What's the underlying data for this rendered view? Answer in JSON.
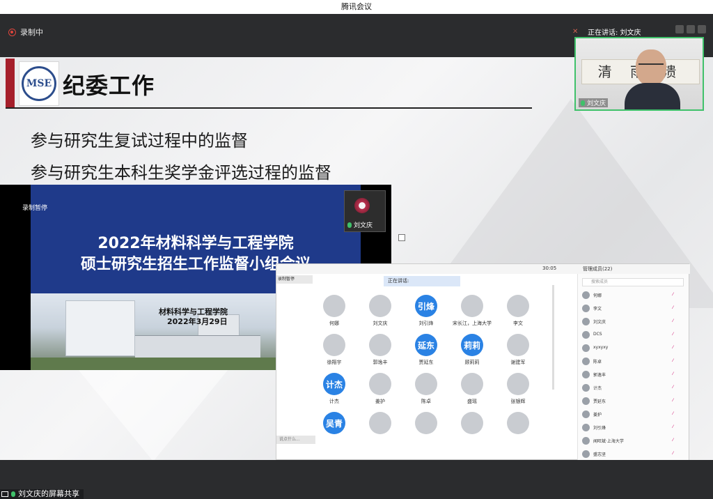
{
  "window": {
    "title": "腾讯会议"
  },
  "topbar": {
    "recording_label": "录制中",
    "speaking_label": "正在讲话: 刘文庆"
  },
  "slide": {
    "logo_text": "MSE",
    "title": "纪委工作",
    "bullets": [
      "参与研究生复试过程中的监督",
      "参与研究生本科生奖学金评选过程的监督"
    ]
  },
  "inner_screen_1": {
    "recording_paused": "录制暂停",
    "heading_line1": "2022年材料科学与工程学院",
    "heading_line2": "硕士研究生招生工作监督小组会议",
    "sub_line1": "材料科学与工程学院",
    "sub_line2": "2022年3月29日",
    "cam_name": "刘文庆"
  },
  "inner_screen_2": {
    "time": "30:05",
    "members_label": "管理成员(22)",
    "rec_pause": "录制暂停",
    "speaking": "正在讲话:",
    "search_placeholder": "搜索成员",
    "chat_placeholder": "说点什么...",
    "tiles": [
      {
        "name": "何娜",
        "avatar": ""
      },
      {
        "name": "刘文庆",
        "avatar": ""
      },
      {
        "name": "刘引烽",
        "avatar": "引烽"
      },
      {
        "name": "宋长江，上海大学",
        "avatar": ""
      },
      {
        "name": "李文",
        "avatar": ""
      },
      {
        "name": "徐翔宇",
        "avatar": ""
      },
      {
        "name": "郭逸丰",
        "avatar": ""
      },
      {
        "name": "贾延东",
        "avatar": "延东"
      },
      {
        "name": "顾莉莉",
        "avatar": "莉莉"
      },
      {
        "name": "谢建军",
        "avatar": ""
      },
      {
        "name": "计杰",
        "avatar": "计杰"
      },
      {
        "name": "姜护",
        "avatar": ""
      },
      {
        "name": "陈卓",
        "avatar": ""
      },
      {
        "name": "盛瑶",
        "avatar": ""
      },
      {
        "name": "张银辉",
        "avatar": ""
      },
      {
        "name": "",
        "avatar": "吴青"
      },
      {
        "name": "",
        "avatar": ""
      },
      {
        "name": "",
        "avatar": ""
      },
      {
        "name": "",
        "avatar": ""
      },
      {
        "name": "",
        "avatar": ""
      }
    ],
    "participants": [
      "何娜",
      "李文",
      "刘文庆",
      "DCS",
      "xyxyxy",
      "陈卓",
      "郭逸丰",
      "计杰",
      "贾延东",
      "姜护",
      "刘引烽",
      "闻旺斌·上海大学",
      "盛志坚"
    ]
  },
  "camera": {
    "name": "刘文庆",
    "calligraphy": "清 雨 溃"
  },
  "bottombar": {
    "share_label": "刘文庆的屏幕共享"
  }
}
